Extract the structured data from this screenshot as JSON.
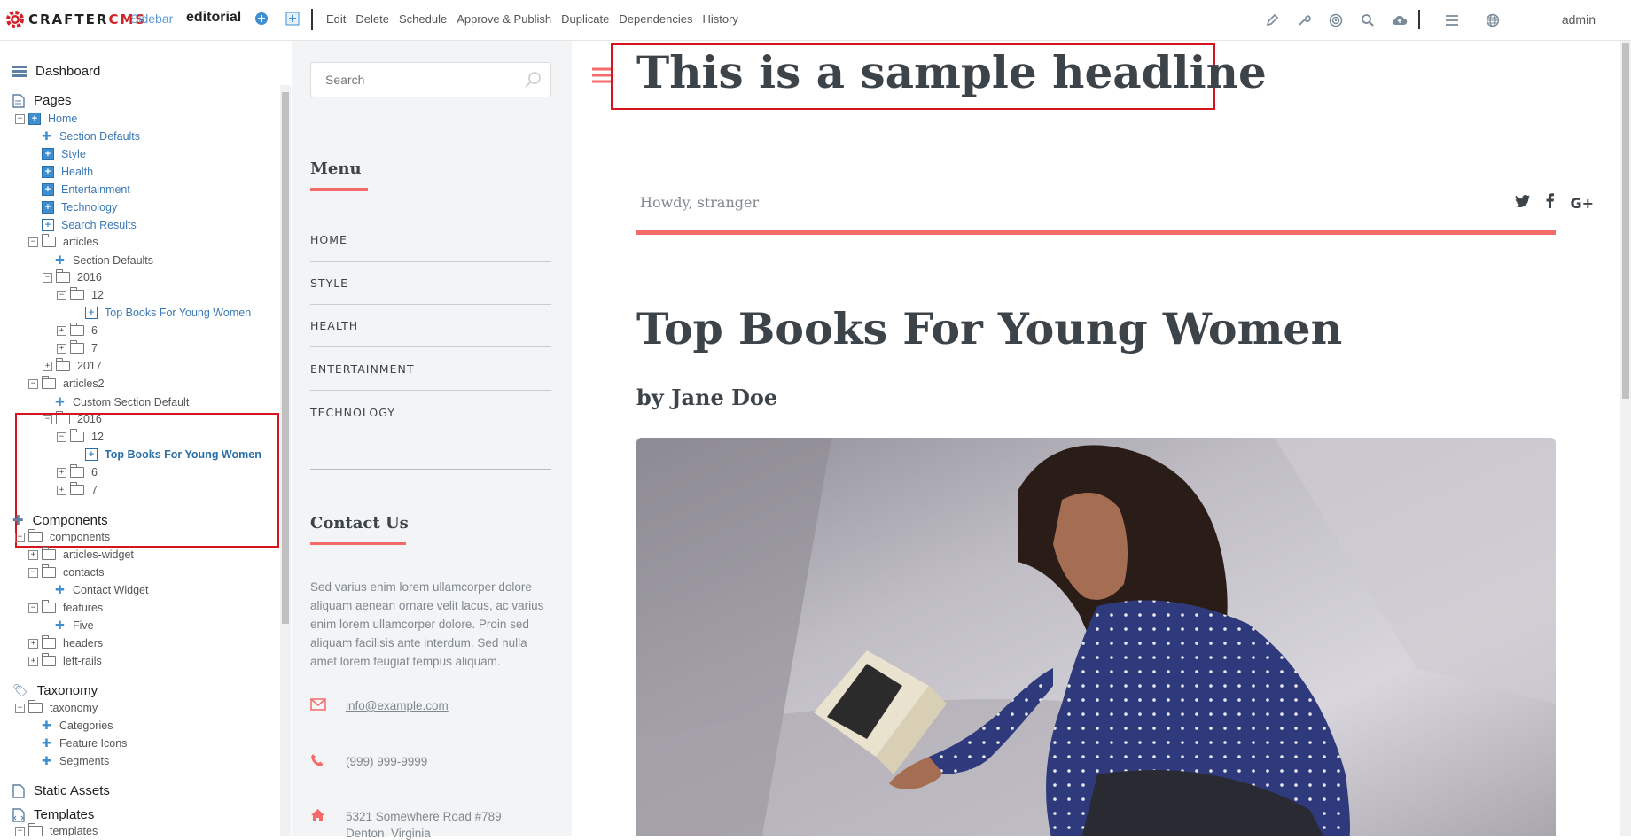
{
  "topbar": {
    "logo_a": "CRAFTER",
    "logo_b": "CMS",
    "sidebar_label": "Sidebar",
    "site_name": "editorial",
    "menu": [
      "Edit",
      "Delete",
      "Schedule",
      "Approve & Publish",
      "Duplicate",
      "Dependencies",
      "History"
    ],
    "icons": [
      "pencil-icon",
      "wrench-icon",
      "target-icon",
      "search-icon",
      "cloud-upload-icon",
      "hamburger-menu-icon",
      "globe-icon"
    ],
    "user": "admin"
  },
  "sidebar": {
    "sections": {
      "dashboard": "Dashboard",
      "pages": "Pages",
      "components": "Components",
      "taxonomy": "Taxonomy",
      "static_assets": "Static Assets",
      "templates": "Templates"
    },
    "pages_tree": {
      "home": "Home",
      "section_defaults": "Section Defaults",
      "style": "Style",
      "health": "Health",
      "entertainment": "Entertainment",
      "technology": "Technology",
      "search_results": "Search Results",
      "articles": "articles",
      "articles_section_defaults": "Section Defaults",
      "y2016": "2016",
      "m12": "12",
      "top_books": "Top Books For Young Women",
      "m6": "6",
      "m7": "7",
      "y2017": "2017",
      "articles2": "articles2",
      "custom_section_default": "Custom Section Default",
      "a2_2016": "2016",
      "a2_12": "12",
      "a2_top_books": "Top Books For Young Women",
      "a2_6": "6",
      "a2_7": "7"
    },
    "components_tree": {
      "components": "components",
      "articles_widget": "articles-widget",
      "contacts": "contacts",
      "contact_widget": "Contact Widget",
      "features": "features",
      "five": "Five",
      "headers": "headers",
      "left_rails": "left-rails"
    },
    "taxonomy_tree": {
      "taxonomy": "taxonomy",
      "categories": "Categories",
      "feature_icons": "Feature Icons",
      "segments": "Segments"
    },
    "templates_tree": {
      "templates": "templates"
    }
  },
  "left_rail": {
    "search_placeholder": "Search",
    "menu_heading": "Menu",
    "menu_items": [
      "HOME",
      "STYLE",
      "HEALTH",
      "ENTERTAINMENT",
      "TECHNOLOGY"
    ],
    "contact_heading": "Contact Us",
    "contact_text": "Sed varius enim lorem ullamcorper dolore aliquam aenean ornare velit lacus, ac varius enim lorem ullamcorper dolore. Proin sed aliquam facilisis ante interdum. Sed nulla amet lorem feugiat tempus aliquam.",
    "email": "info@example.com",
    "phone": "(999) 999-9999",
    "address": "5321 Somewhere Road #789",
    "address2": "Denton, Virginia"
  },
  "main": {
    "headline": "This is a sample headline",
    "greeting": "Howdy, stranger",
    "article_title": "Top Books For Young Women",
    "byline": "by Jane Doe",
    "accent_color": "#f56a6a"
  }
}
